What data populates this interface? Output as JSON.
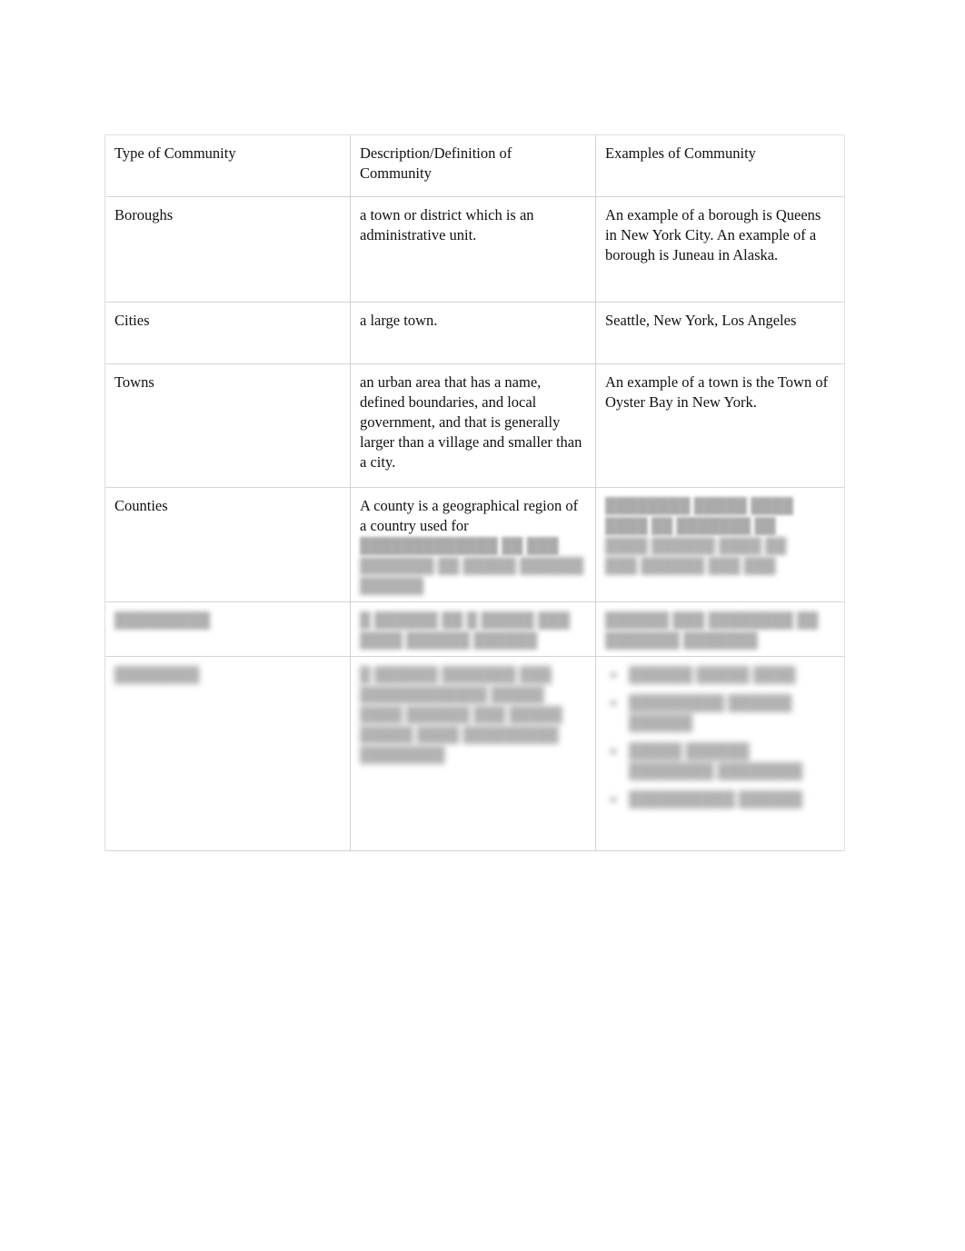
{
  "page": {
    "background_color": "#ffffff",
    "text_color": "#111111",
    "border_color": "#d2d2d2"
  },
  "table": {
    "name": "types-of-community",
    "columns": [
      "Type of Community",
      "Description/Definition of Community",
      "Examples of Community"
    ],
    "rows": [
      {
        "type": "Boroughs",
        "type_legible": true,
        "description": "a town or district which is an administrative unit.",
        "description_legible": true,
        "examples": "An example of a borough is Queens in New York City. An example of a borough is Juneau in Alaska.",
        "examples_legible": true
      },
      {
        "type": "Cities",
        "type_legible": true,
        "description": "a large town.",
        "description_legible": true,
        "examples": "Seattle, New York, Los Angeles",
        "examples_legible": true
      },
      {
        "type": "Towns",
        "type_legible": true,
        "description": "an urban area that has a name, defined boundaries, and local government, and that is generally larger than a village and smaller than a city.",
        "description_legible": true,
        "examples": "An example of a town is the Town of Oyster Bay in New York.",
        "examples_legible": true
      },
      {
        "type": "Counties",
        "type_legible": true,
        "description_visible": "A county is a geographical region of a country used for",
        "description_legible": "partial",
        "description_blurred_lines": [
          "█████████████ ██ ███",
          "███████ ██ █████ ██████",
          "██████"
        ],
        "examples_legible": false,
        "examples_blurred_lines": [
          "████████ █████ ████",
          "████ ██ ███████ ██",
          "████ ██████ ████ ██",
          "███ ██████ ███ ███"
        ]
      },
      {
        "type_legible": false,
        "type_blurred": "█████████",
        "description_legible": false,
        "description_blurred_lines": [
          "█ ██████ ██ █ █████ ███",
          "████ ██████ ██████"
        ],
        "examples_legible": false,
        "examples_blurred_lines": [
          "██████ ███ ████████ ██",
          "███████ ███████"
        ]
      },
      {
        "type_legible": false,
        "type_blurred": "████████",
        "description_legible": false,
        "description_blurred_lines": [
          "█ ██████ ███████ ███",
          "████████████ █████",
          "████ ██████ ███ █████",
          "█████ ████ █████████",
          "████████"
        ],
        "examples_legible": false,
        "examples_is_bulleted_list": true,
        "examples_bullets": [
          "██████ █████ ████",
          "█████████ ██████\n██████",
          "█████ ██████\n████████ ████████",
          "██████████ ██████"
        ]
      }
    ]
  }
}
